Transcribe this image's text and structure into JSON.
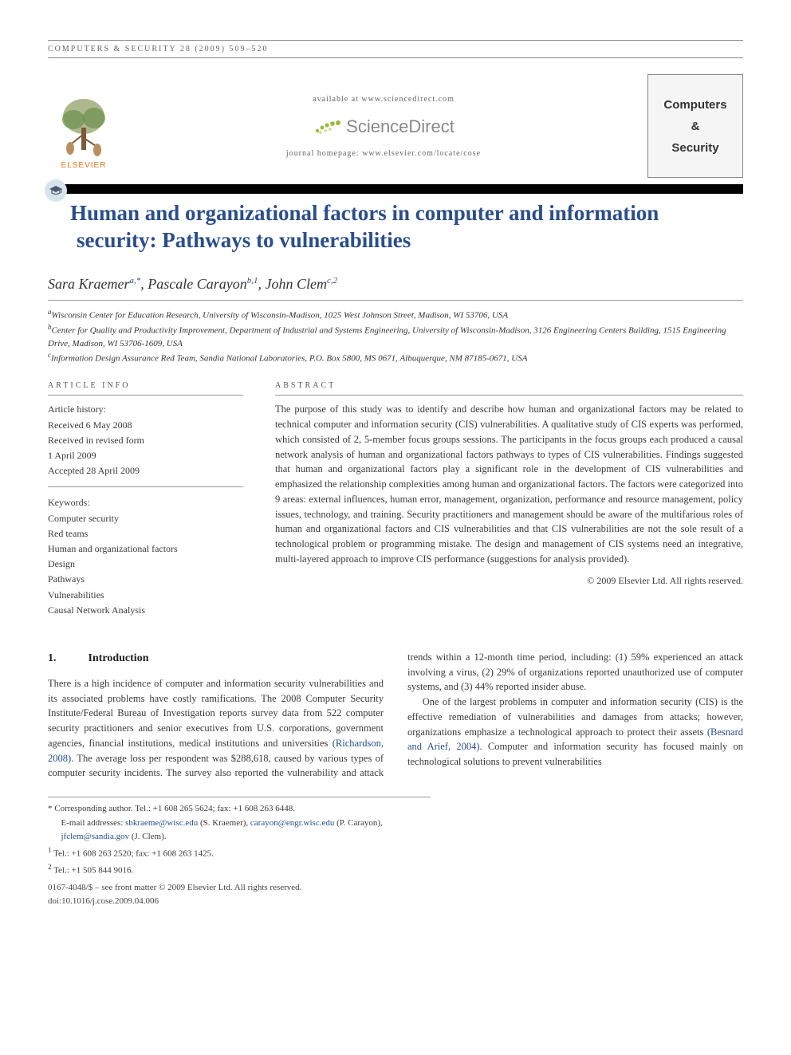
{
  "running_head": "COMPUTERS & SECURITY 28 (2009) 509–520",
  "masthead": {
    "available": "available at www.sciencedirect.com",
    "sd_name": "ScienceDirect",
    "homepage": "journal homepage: www.elsevier.com/locate/cose",
    "elsevier": "ELSEVIER",
    "journal_line1": "Computers",
    "journal_line2": "&",
    "journal_line3": "Security"
  },
  "title": "Human and organizational factors in computer and information security: Pathways to vulnerabilities",
  "authors": [
    {
      "name": "Sara Kraemer",
      "affil": "a,",
      "mark": "*"
    },
    {
      "name": "Pascale Carayon",
      "affil": "b,1",
      "mark": ""
    },
    {
      "name": "John Clem",
      "affil": "c,2",
      "mark": ""
    }
  ],
  "affiliations": {
    "a": "Wisconsin Center for Education Research, University of Wisconsin-Madison, 1025 West Johnson Street, Madison, WI 53706, USA",
    "b": "Center for Quality and Productivity Improvement, Department of Industrial and Systems Engineering, University of Wisconsin-Madison, 3126 Engineering Centers Building, 1515 Engineering Drive, Madison, WI 53706-1609, USA",
    "c": "Information Design Assurance Red Team, Sandia National Laboratories, P.O. Box 5800, MS 0671, Albuquerque, NM 87185-0671, USA"
  },
  "info_label": "ARTICLE INFO",
  "abstract_label": "ABSTRACT",
  "history": {
    "title": "Article history:",
    "received": "Received 6 May 2008",
    "revised1": "Received in revised form",
    "revised2": "1 April 2009",
    "accepted": "Accepted 28 April 2009"
  },
  "keywords": {
    "title": "Keywords:",
    "items": [
      "Computer security",
      "Red teams",
      "Human and organizational factors",
      "Design",
      "Pathways",
      "Vulnerabilities",
      "Causal Network Analysis"
    ]
  },
  "abstract": "The purpose of this study was to identify and describe how human and organizational factors may be related to technical computer and information security (CIS) vulnerabilities. A qualitative study of CIS experts was performed, which consisted of 2, 5-member focus groups sessions. The participants in the focus groups each produced a causal network analysis of human and organizational factors pathways to types of CIS vulnerabilities. Findings suggested that human and organizational factors play a significant role in the development of CIS vulnerabilities and emphasized the relationship complexities among human and organizational factors. The factors were categorized into 9 areas: external influences, human error, management, organization, performance and resource management, policy issues, technology, and training. Security practitioners and management should be aware of the multifarious roles of human and organizational factors and CIS vulnerabilities and that CIS vulnerabilities are not the sole result of a technological problem or programming mistake. The design and management of CIS systems need an integrative, multi-layered approach to improve CIS performance (suggestions for analysis provided).",
  "copyright_line": "© 2009 Elsevier Ltd. All rights reserved.",
  "section1": {
    "num": "1.",
    "heading": "Introduction",
    "p1a": "There is a high incidence of computer and information security vulnerabilities and its associated problems have costly ramifications. The 2008 Computer Security Institute/Federal Bureau of Investigation reports survey data from 522 computer security practitioners and senior executives from U.S. corporations, government agencies, financial institutions, medical institutions and universities ",
    "p1_link": "(Richardson, 2008)",
    "p1b": ". The average loss per respondent was $288,618, caused by various types of computer security incidents. The survey also reported the vulnerability and attack trends within a 12-month time period, including: (1) 59% experienced an attack involving a virus, (2) 29% of organizations reported unauthorized use of computer systems, and (3) 44% reported insider abuse.",
    "p2a": "One of the largest problems in computer and information security (CIS) is the effective remediation of vulnerabilities and damages from attacks; however, organizations emphasize a technological approach to protect their assets ",
    "p2_link": "(Besnard and Arief, 2004)",
    "p2b": ". Computer and information security has focused mainly on technological solutions to prevent vulnerabilities"
  },
  "footnotes": {
    "corr": "* Corresponding author. Tel.: +1 608 265 5624; fax: +1 608 263 6448.",
    "emails_label": "E-mail addresses: ",
    "email1": "sbkraeme@wisc.edu",
    "email1_person": " (S. Kraemer), ",
    "email2": "carayon@engr.wisc.edu",
    "email2_person": " (P. Carayon), ",
    "email3": "jfclem@sandia.gov",
    "email3_person": " (J. Clem).",
    "tel1": "Tel.: +1 608 263 2520; fax: +1 608 263 1425.",
    "tel2": "Tel.: +1 505 844 9016.",
    "issn": "0167-4048/$ – see front matter © 2009 Elsevier Ltd. All rights reserved.",
    "doi": "doi:10.1016/j.cose.2009.04.006"
  }
}
